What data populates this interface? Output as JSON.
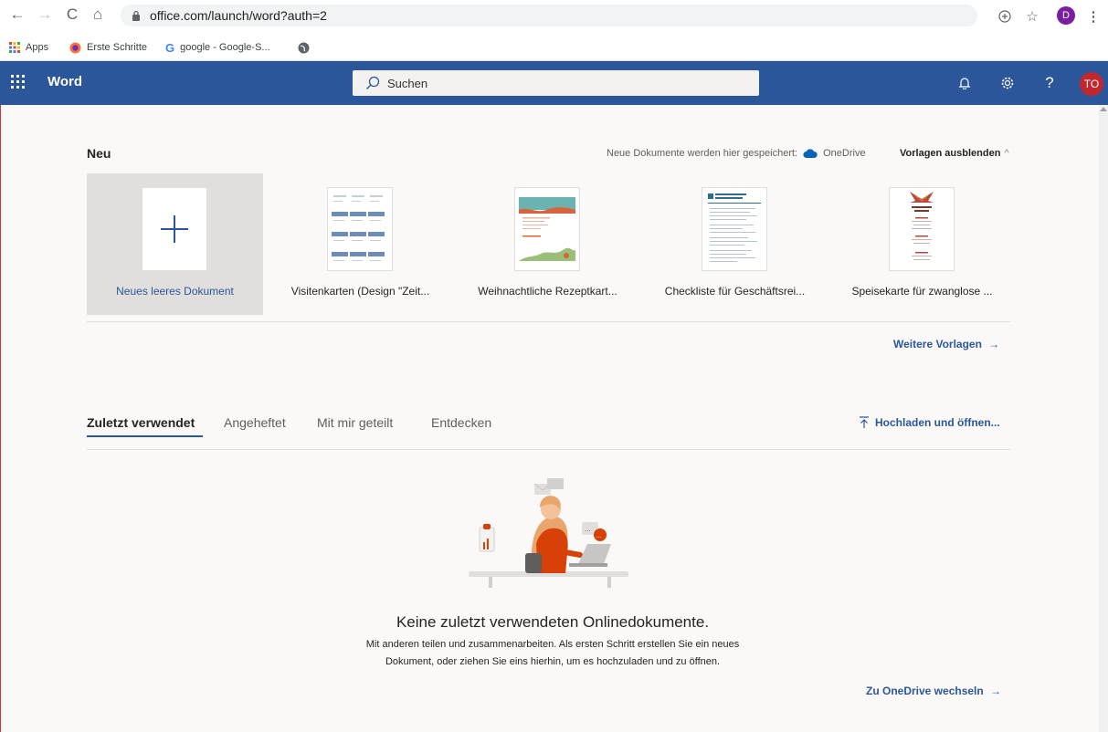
{
  "browser": {
    "url": "office.com/launch/word?auth=2",
    "profile_initial": "D",
    "bookmarks": [
      {
        "label": "Apps",
        "icon": "apps-grid-icon"
      },
      {
        "label": "Erste Schritte",
        "icon": "firefox-icon"
      },
      {
        "label": "google - Google-S...",
        "icon": "google-icon"
      },
      {
        "label": "",
        "icon": "globe-icon"
      }
    ]
  },
  "suite": {
    "app_name": "Word",
    "search_placeholder": "Suchen",
    "user_initials": "TO",
    "brand_color": "#2b579a"
  },
  "new_section": {
    "title": "Neu",
    "save_note": "Neue Dokumente werden hier gespeichert:",
    "save_location": "OneDrive",
    "hide_templates": "Vorlagen ausblenden",
    "templates": [
      {
        "label": "Neues leeres Dokument"
      },
      {
        "label": "Visitenkarten (Design \"Zeit..."
      },
      {
        "label": "Weihnachtliche Rezeptkart..."
      },
      {
        "label": "Checkliste für Geschäftsrei..."
      },
      {
        "label": "Speisekarte für zwanglose ..."
      }
    ],
    "more_templates": "Weitere Vorlagen",
    "arrow": "→"
  },
  "tabs": {
    "items": [
      "Zuletzt verwendet",
      "Angeheftet",
      "Mit mir geteilt",
      "Entdecken"
    ],
    "active_index": 0,
    "upload": "Hochladen und öffnen..."
  },
  "empty_state": {
    "title": "Keine zuletzt verwendeten Onlinedokumente.",
    "line1": "Mit anderen teilen und zusammenarbeiten. Als ersten Schritt erstellen Sie ein neues",
    "line2": "Dokument, oder ziehen Sie eins hierhin, um es hochzuladen und zu öffnen.",
    "link": "Zu OneDrive wechseln"
  }
}
